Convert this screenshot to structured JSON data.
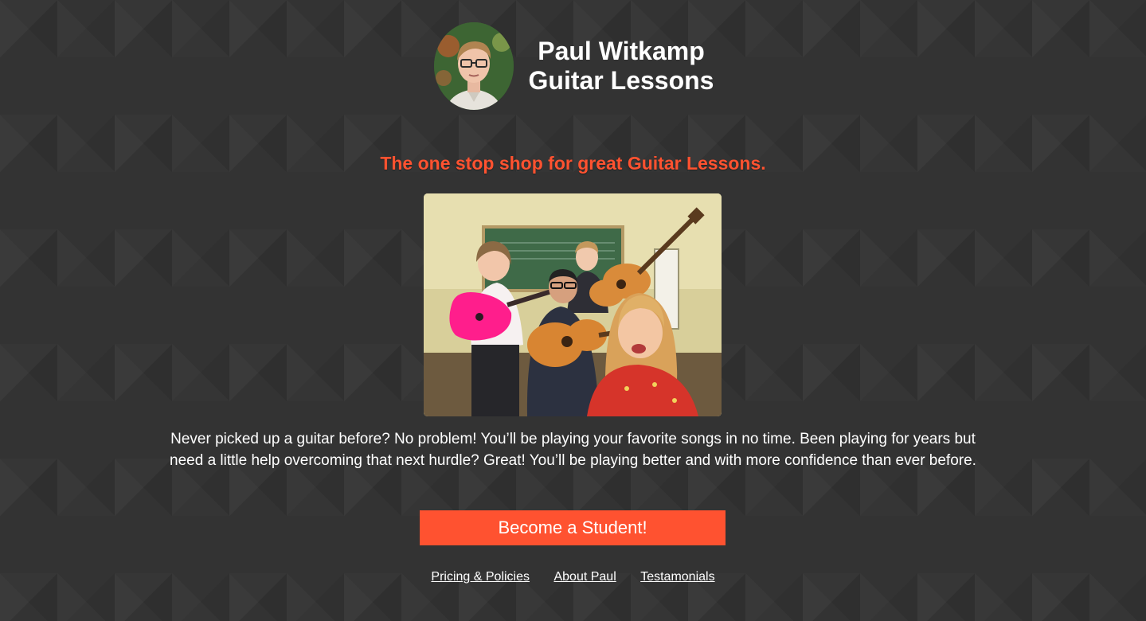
{
  "header": {
    "title_line1": "Paul Witkamp",
    "title_line2": "Guitar Lessons",
    "avatar_alt": "Paul Witkamp portrait"
  },
  "tagline": "The one stop shop for great Guitar Lessons.",
  "hero": {
    "alt": "Kids playing guitars in a classroom"
  },
  "description": "Never picked up a guitar before? No problem! You’ll be playing your favorite songs in no time. Been playing for years but need a little help overcoming that next hurdle? Great! You’ll be playing better and with more confidence than ever before.",
  "cta": {
    "label": "Become a Student!"
  },
  "footer": {
    "links": [
      {
        "label": "Pricing & Policies"
      },
      {
        "label": "About Paul"
      },
      {
        "label": "Testamonials"
      }
    ]
  },
  "colors": {
    "background": "#333333",
    "accent": "#ff5230",
    "text": "#ffffff"
  }
}
